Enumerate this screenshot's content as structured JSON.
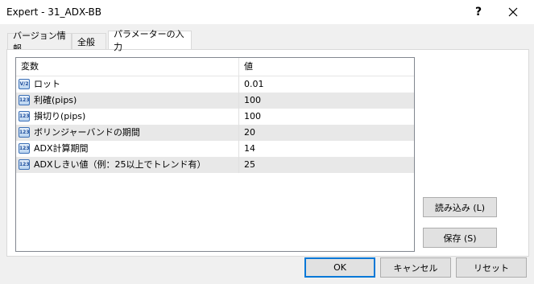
{
  "window": {
    "title": "Expert - 31_ADX-BB",
    "help": "?"
  },
  "tabs": [
    {
      "label": "バージョン情報"
    },
    {
      "label": "全般"
    },
    {
      "label": "パラメーターの入力"
    }
  ],
  "grid": {
    "columns": [
      "変数",
      "値"
    ],
    "rows": [
      {
        "icon": "V/2",
        "name": "ロット",
        "value": "0.01"
      },
      {
        "icon": "123",
        "name": "利確(pips)",
        "value": "100"
      },
      {
        "icon": "123",
        "name": "損切り(pips)",
        "value": "100"
      },
      {
        "icon": "123",
        "name": "ボリンジャーバンドの期間",
        "value": "20"
      },
      {
        "icon": "123",
        "name": "ADX計算期間",
        "value": "14"
      },
      {
        "icon": "123",
        "name": "ADXしきい値（例：25以上でトレンド有）",
        "value": "25"
      }
    ]
  },
  "buttons": {
    "load": "読み込み (L)",
    "save": "保存 (S)",
    "ok": "OK",
    "cancel": "キャンセル",
    "reset": "リセット"
  }
}
